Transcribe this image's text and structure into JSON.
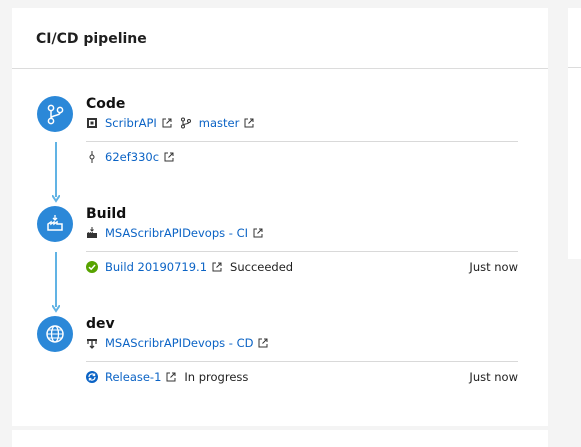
{
  "title": "CI/CD pipeline",
  "colors": {
    "accent": "#2b88d8",
    "link": "#0b63c5",
    "connector": "#61b3e4",
    "success": "#57a300"
  },
  "stages": {
    "code": {
      "name": "Code",
      "icon": "git-branch-icon",
      "repo": "ScribrAPI",
      "branch": "master",
      "commit": "62ef330c"
    },
    "build": {
      "name": "Build",
      "icon": "build-icon",
      "pipeline": "MSAScribrAPIDevops - CI",
      "run": "Build 20190719.1",
      "status": "Succeeded",
      "time": "Just now"
    },
    "dev": {
      "name": "dev",
      "icon": "globe-icon",
      "pipeline": "MSAScribrAPIDevops - CD",
      "run": "Release-1",
      "status": "In progress",
      "time": "Just now"
    }
  }
}
